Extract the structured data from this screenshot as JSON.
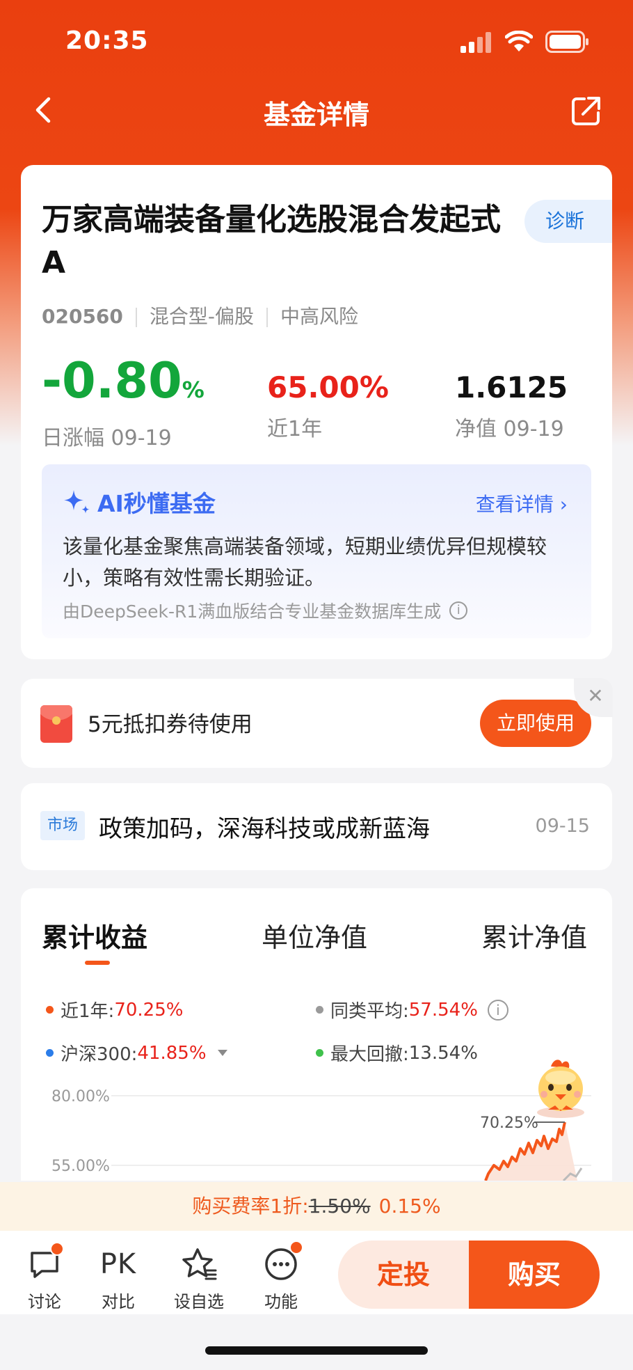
{
  "status": {
    "time": "20:35"
  },
  "nav": {
    "title": "基金详情"
  },
  "fund": {
    "name": "万家高端装备量化选股混合发起式A",
    "diagnose_label": "诊断",
    "code": "020560",
    "type": "混合型-偏股",
    "risk": "中高风险",
    "metrics": {
      "daily": {
        "value": "-0.80",
        "unit": "%",
        "label": "日涨幅 09-19"
      },
      "year": {
        "value": "65.00%",
        "label": "近1年"
      },
      "nav": {
        "value": "1.6125",
        "label": "净值 09-19"
      }
    }
  },
  "ai": {
    "title": "AI秒懂基金",
    "more": "查看详情",
    "text": "该量化基金聚焦高端装备领域，短期业绩优异但规模较小，策略有效性需长期验证。",
    "note": "由DeepSeek-R1满血版结合专业基金数据库生成"
  },
  "coupon": {
    "text": "5元抵扣券待使用",
    "button": "立即使用",
    "close": "✕"
  },
  "news": {
    "tag": "市场",
    "title": "政策加码，深海科技或成新蓝海",
    "date": "09-15"
  },
  "chart_tabs": [
    "累计收益",
    "单位净值",
    "累计净值"
  ],
  "legend": {
    "l1": {
      "label": "近1年:",
      "value": "70.25%"
    },
    "l2": {
      "label": "同类平均:",
      "value": "57.54%"
    },
    "l3": {
      "label": "沪深300:",
      "value": "41.85%"
    },
    "l4": {
      "label": "最大回撤:",
      "value": "13.54%"
    }
  },
  "chart_data": {
    "type": "line",
    "yticks": [
      "80.00%",
      "55.00%"
    ],
    "annotation": "70.25%",
    "series": [
      {
        "name": "近1年",
        "last_value": 70.25
      }
    ]
  },
  "fee": {
    "prefix": "购买费率1折:",
    "old": "1.50%",
    "new": "0.15%"
  },
  "bottom": {
    "discuss": "讨论",
    "compare_icon": "PK",
    "compare": "对比",
    "watch": "设自选",
    "functions": "功能",
    "sip": "定投",
    "buy": "购买"
  },
  "colors": {
    "brand": "#ea3f0f",
    "up": "#e8221a",
    "down": "#13a63b",
    "ai": "#3c6bf2"
  }
}
